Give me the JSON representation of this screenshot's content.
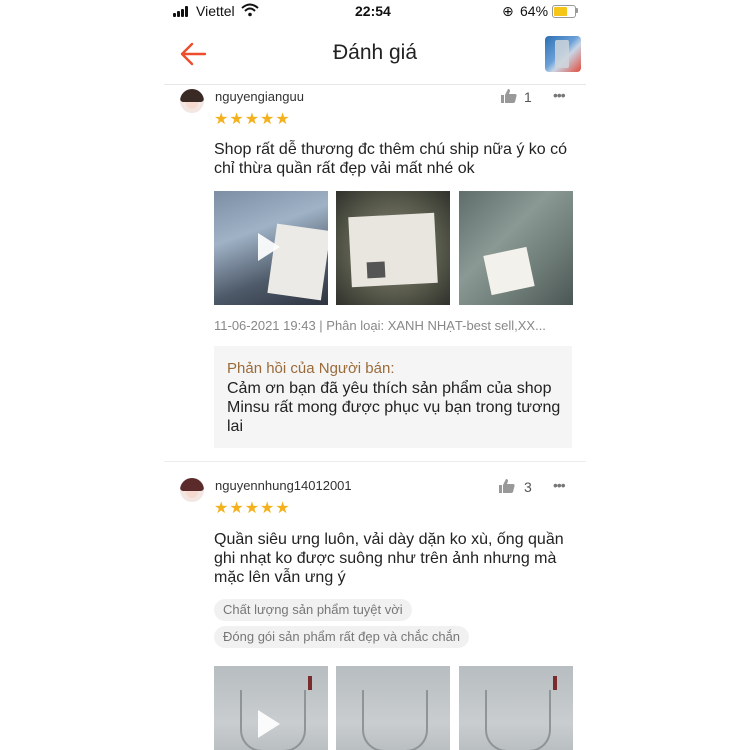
{
  "status_bar": {
    "carrier": "Viettel",
    "time": "22:54",
    "battery_percent": "64%",
    "battery_level": 0.64,
    "icons": [
      "signal-icon",
      "wifi-icon",
      "orientation-lock-icon",
      "battery-icon"
    ]
  },
  "header": {
    "title": "Đánh giá",
    "back_icon": "arrow-left-icon",
    "accent_color": "#ee4d2d"
  },
  "reviews": [
    {
      "username": "nguyengianguu",
      "likes": "1",
      "rating": 5,
      "stars": "★★★★★",
      "text": "Shop rất dễ thương đc thêm chú ship nữa ý ko có chỉ thừa quần rất đẹp vải mất nhé ok",
      "media": [
        "video-thumbnail",
        "photo",
        "photo"
      ],
      "meta": "11-06-2021 19:43 | Phân loại: XANH NHẠT-best sell,XX...",
      "seller_reply": {
        "title": "Phản hồi của Người bán:",
        "text": "Cảm ơn bạn đã yêu thích sản phẩm của shop Minsu rất mong được phục vụ bạn trong tương lai"
      }
    },
    {
      "username": "nguyennhung14012001",
      "likes": "3",
      "rating": 5,
      "stars": "★★★★★",
      "text": "Quần siêu ưng luôn, vải dày dặn ko xù, ống quần ghi nhạt ko được suông như trên ảnh nhưng mà mặc lên vẫn ưng ý",
      "tags": [
        "Chất lượng sản phẩm tuyệt vời",
        "Đóng gói sản phẩm rất đẹp và chắc chắn"
      ],
      "media": [
        "video-thumbnail",
        "photo",
        "photo"
      ]
    }
  ],
  "colors": {
    "star": "#f3b21d",
    "reply_title": "#9a6b3a",
    "reply_bg": "#f5f5f5"
  }
}
